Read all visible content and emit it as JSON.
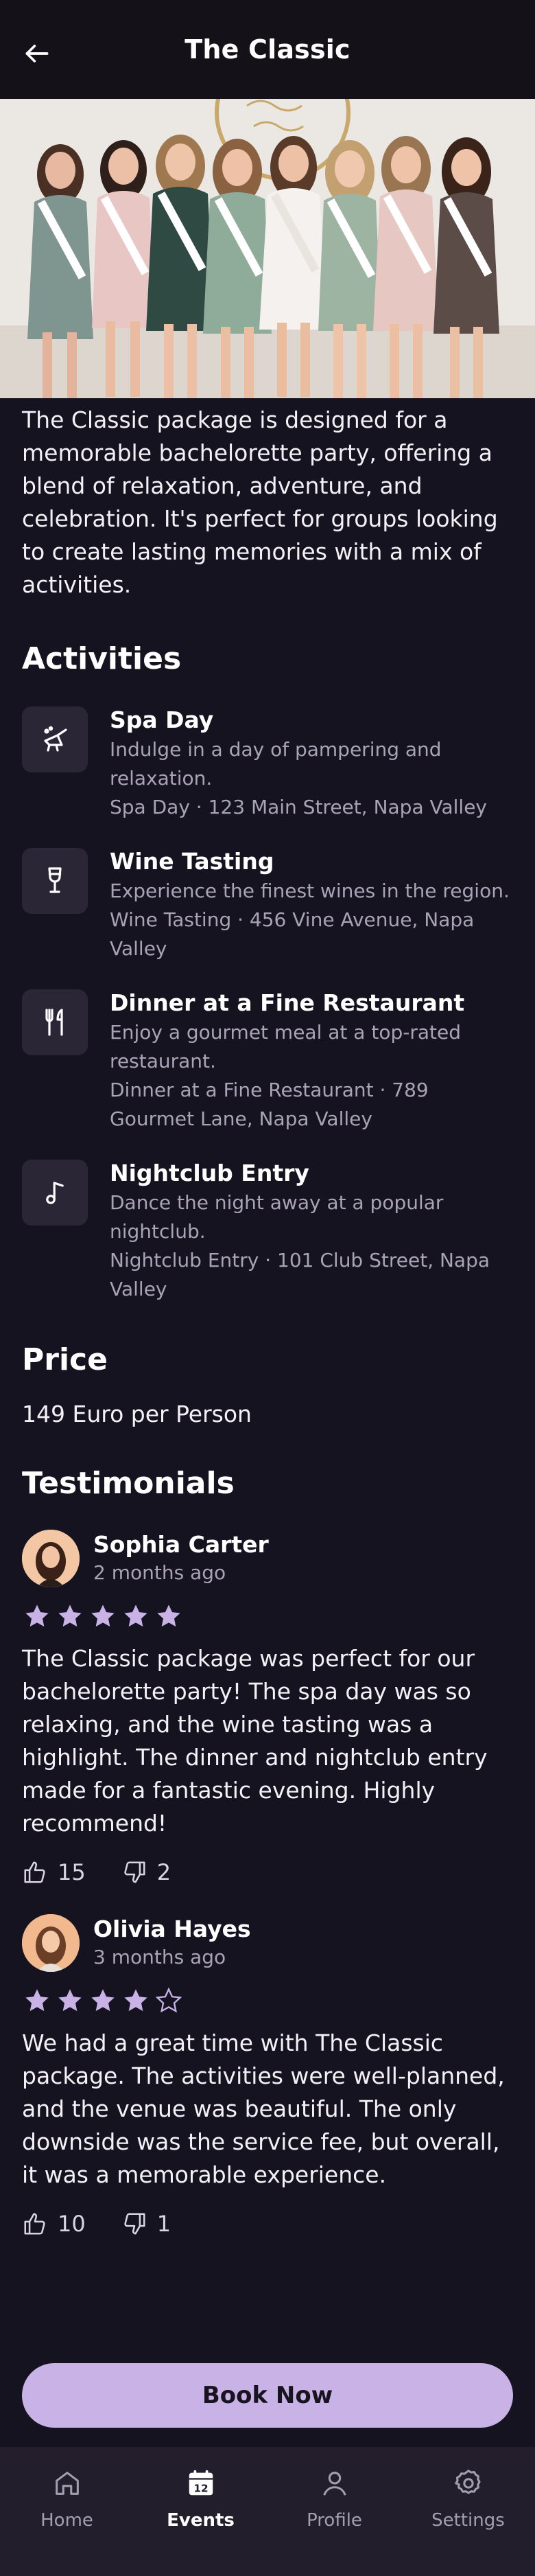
{
  "header": {
    "title": "The Classic",
    "back_icon": "arrow-left-icon"
  },
  "description": "The Classic package is designed for a memorable bachelorette party, offering a blend of relaxation, adventure, and celebration. It's perfect for groups looking to create lasting memories with a mix of activities.",
  "activities": {
    "title": "Activities",
    "items": [
      {
        "icon": "spa-icon",
        "name": "Spa Day",
        "text": "Indulge in a day of pampering and relaxation.",
        "location": "Spa Day · 123 Main Street, Napa Valley"
      },
      {
        "icon": "wine-glass-icon",
        "name": "Wine Tasting",
        "text": "Experience the finest wines in the region.",
        "location": "Wine Tasting · 456 Vine Avenue, Napa Valley"
      },
      {
        "icon": "fork-knife-icon",
        "name": "Dinner at a Fine Restaurant",
        "text": "Enjoy a gourmet meal at a top-rated restaurant.",
        "location": "Dinner at a Fine Restaurant · 789 Gourmet Lane, Napa Valley"
      },
      {
        "icon": "music-note-icon",
        "name": "Nightclub Entry",
        "text": "Dance the night away at a popular nightclub.",
        "location": "Nightclub Entry · 101 Club Street, Napa Valley"
      }
    ]
  },
  "price": {
    "title": "Price",
    "text": "149 Euro per Person"
  },
  "testimonials": {
    "title": "Testimonials",
    "reviews": [
      {
        "name": "Sophia Carter",
        "date": "2 months ago",
        "rating": 5,
        "text": "The Classic package was perfect for our bachelorette party! The spa day was so relaxing, and the wine tasting was a highlight. The dinner and nightclub entry made for a fantastic evening. Highly recommend!",
        "likes": "15",
        "dislikes": "2"
      },
      {
        "name": "Olivia Hayes",
        "date": "3 months ago",
        "rating": 4,
        "text": "We had a great time with The Classic package. The activities were well-planned, and the venue was beautiful. The only downside was the service fee, but overall, it was a memorable experience.",
        "likes": "10",
        "dislikes": "1"
      }
    ]
  },
  "book_button": "Book Now",
  "nav": [
    {
      "label": "Home",
      "icon": "home-icon",
      "active": false
    },
    {
      "label": "Events",
      "icon": "calendar-icon",
      "active": true,
      "badge": "12"
    },
    {
      "label": "Profile",
      "icon": "person-icon",
      "active": false
    },
    {
      "label": "Settings",
      "icon": "gear-icon",
      "active": false
    }
  ],
  "colors": {
    "background": "#161320",
    "accent": "#c8b2e6",
    "card": "#2a2636",
    "muted_text": "#a9a3b6"
  }
}
